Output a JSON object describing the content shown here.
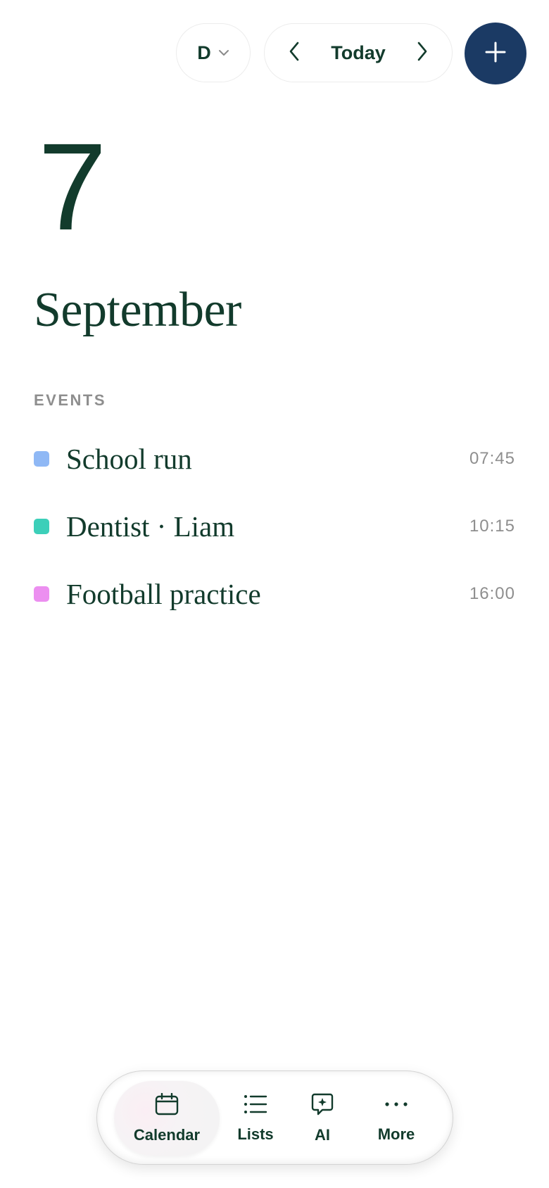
{
  "toolbar": {
    "view_select_label": "D",
    "today_label": "Today",
    "colors": {
      "add_button": "#1b3a64"
    }
  },
  "date": {
    "day": "7",
    "month": "September"
  },
  "events_section": {
    "heading": "EVENTS",
    "events": [
      {
        "title": "School run",
        "time": "07:45",
        "color": "#8fb8f5"
      },
      {
        "title": "Dentist · Liam",
        "time": "10:15",
        "color": "#3ccfb9"
      },
      {
        "title": "Football practice",
        "time": "16:00",
        "color": "#ec8ff0"
      }
    ]
  },
  "tab_bar": {
    "active": "Calendar",
    "tabs": [
      {
        "label": "Calendar",
        "icon": "calendar-icon"
      },
      {
        "label": "Lists",
        "icon": "list-icon"
      },
      {
        "label": "AI",
        "icon": "ai-chat-icon"
      },
      {
        "label": "More",
        "icon": "more-icon"
      }
    ]
  },
  "theme": {
    "text_primary": "#123b2c",
    "text_muted": "#8e8e8e",
    "background": "#ffffff"
  }
}
